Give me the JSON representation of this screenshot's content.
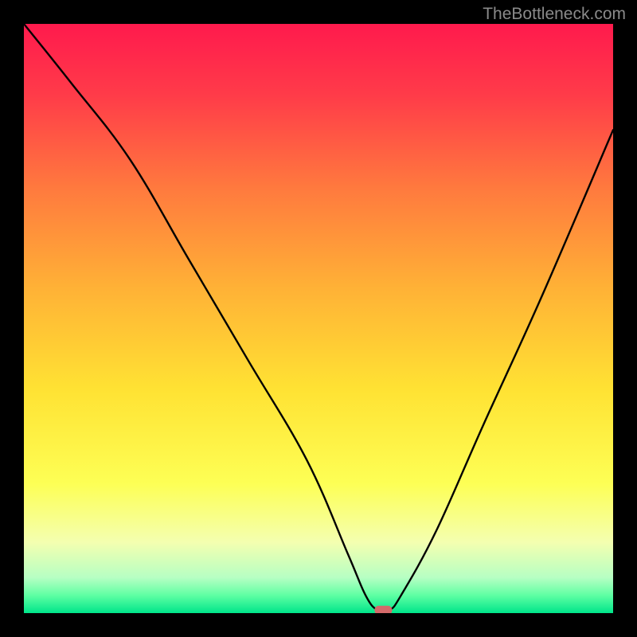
{
  "credit": "TheBottleneck.com",
  "chart_data": {
    "type": "line",
    "title": "",
    "xlabel": "",
    "ylabel": "",
    "xlim": [
      0,
      100
    ],
    "ylim": [
      0,
      100
    ],
    "grid": false,
    "background": "vertical-gradient",
    "gradient_stops": [
      {
        "pos": 0.0,
        "color": "#ff1a4d"
      },
      {
        "pos": 0.12,
        "color": "#ff3b49"
      },
      {
        "pos": 0.28,
        "color": "#ff7a3e"
      },
      {
        "pos": 0.45,
        "color": "#ffb236"
      },
      {
        "pos": 0.62,
        "color": "#ffe233"
      },
      {
        "pos": 0.78,
        "color": "#fdff55"
      },
      {
        "pos": 0.88,
        "color": "#f4ffb0"
      },
      {
        "pos": 0.94,
        "color": "#b6ffc3"
      },
      {
        "pos": 0.97,
        "color": "#5effa3"
      },
      {
        "pos": 1.0,
        "color": "#00e58a"
      }
    ],
    "curve": {
      "name": "bottleneck-curve",
      "x": [
        0,
        8,
        18,
        28,
        38,
        48,
        55,
        58,
        60,
        62,
        64,
        70,
        78,
        88,
        100
      ],
      "y": [
        100,
        90,
        77,
        60,
        43,
        26,
        10,
        3,
        0.5,
        0.5,
        3,
        14,
        32,
        54,
        82
      ]
    },
    "marker": {
      "name": "optimal-point",
      "x": 61,
      "y": 0.5,
      "color": "#d46a6a",
      "shape": "rounded-rect"
    }
  }
}
